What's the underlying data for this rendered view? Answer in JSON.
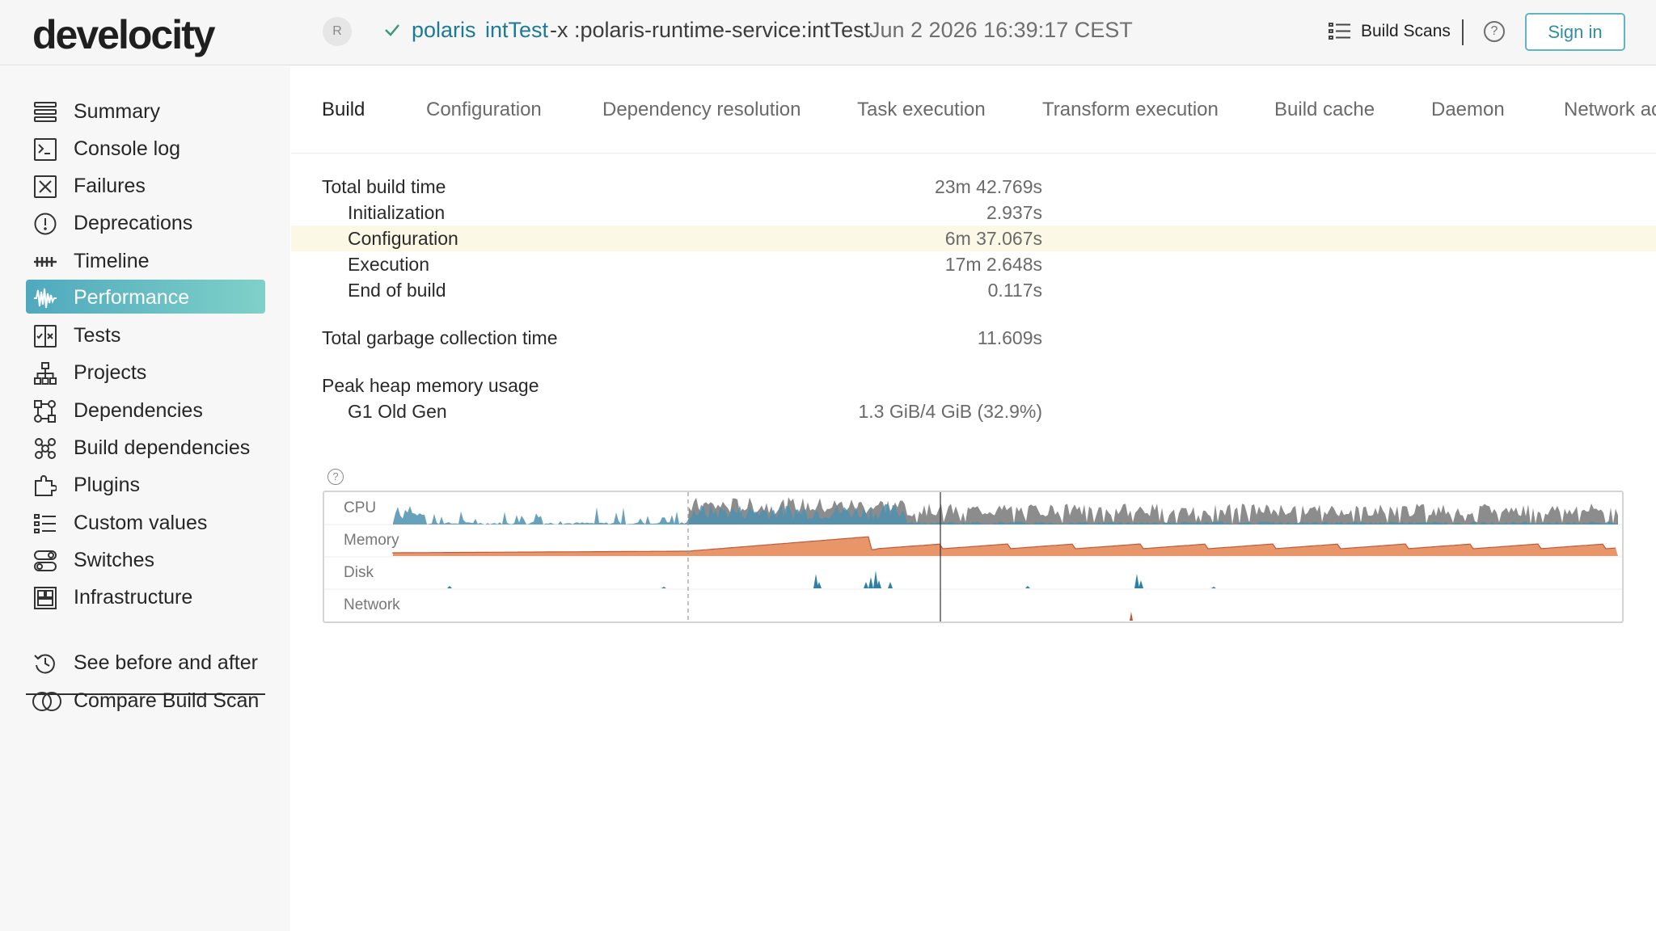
{
  "header": {
    "logo": "develocity",
    "avatar_letter": "R",
    "project": "polaris",
    "task": "intTest",
    "args": "-x :polaris-runtime-service:intTest",
    "datetime": "Jun 2 2026 16:39:17 CEST",
    "build_scans": "Build Scans",
    "help": "?",
    "sign_in": "Sign in"
  },
  "sidebar": {
    "items": [
      {
        "label": "Summary",
        "icon": "list-icon"
      },
      {
        "label": "Console log",
        "icon": "terminal-icon"
      },
      {
        "label": "Failures",
        "icon": "x-box-icon"
      },
      {
        "label": "Deprecations",
        "icon": "alert-circle-icon"
      },
      {
        "label": "Timeline",
        "icon": "timeline-icon"
      },
      {
        "label": "Performance",
        "icon": "waveform-icon",
        "active": true
      },
      {
        "label": "Tests",
        "icon": "tests-icon"
      },
      {
        "label": "Projects",
        "icon": "hierarchy-icon"
      },
      {
        "label": "Dependencies",
        "icon": "dependencies-icon"
      },
      {
        "label": "Build dependencies",
        "icon": "build-dependencies-icon"
      },
      {
        "label": "Plugins",
        "icon": "plugin-icon"
      },
      {
        "label": "Custom values",
        "icon": "custom-values-icon"
      },
      {
        "label": "Switches",
        "icon": "switches-icon"
      },
      {
        "label": "Infrastructure",
        "icon": "infrastructure-icon"
      }
    ],
    "bottom_items": [
      {
        "label": "See before and after",
        "icon": "history-icon"
      },
      {
        "label": "Compare Build Scan",
        "icon": "compare-icon"
      }
    ]
  },
  "tabs": [
    "Build",
    "Configuration",
    "Dependency resolution",
    "Task execution",
    "Transform execution",
    "Build cache",
    "Daemon",
    "Network ac"
  ],
  "active_tab": "Build",
  "stats": {
    "total_build_time": {
      "label": "Total build time",
      "value": "23m 42.769s"
    },
    "initialization": {
      "label": "Initialization",
      "value": "2.937s"
    },
    "configuration": {
      "label": "Configuration",
      "value": "6m 37.067s"
    },
    "execution": {
      "label": "Execution",
      "value": "17m 2.648s"
    },
    "end_of_build": {
      "label": "End of build",
      "value": "0.117s"
    },
    "gc_time": {
      "label": "Total garbage collection time",
      "value": "11.609s"
    },
    "peak_heap": {
      "label": "Peak heap memory usage"
    },
    "g1_old_gen": {
      "label": "G1 Old Gen",
      "value": "1.3 GiB/4 GiB (32.9%)"
    }
  },
  "perf_chart": {
    "help": "?",
    "lanes": [
      "CPU",
      "Memory",
      "Disk",
      "Network"
    ],
    "colors": {
      "cpu_blue": "#4e90b0",
      "cpu_gray": "#8c8c8c",
      "memory": "#e8956a",
      "memory_line": "#c25a3a",
      "disk": "#2f7fa6",
      "network": "#c0562e"
    }
  }
}
